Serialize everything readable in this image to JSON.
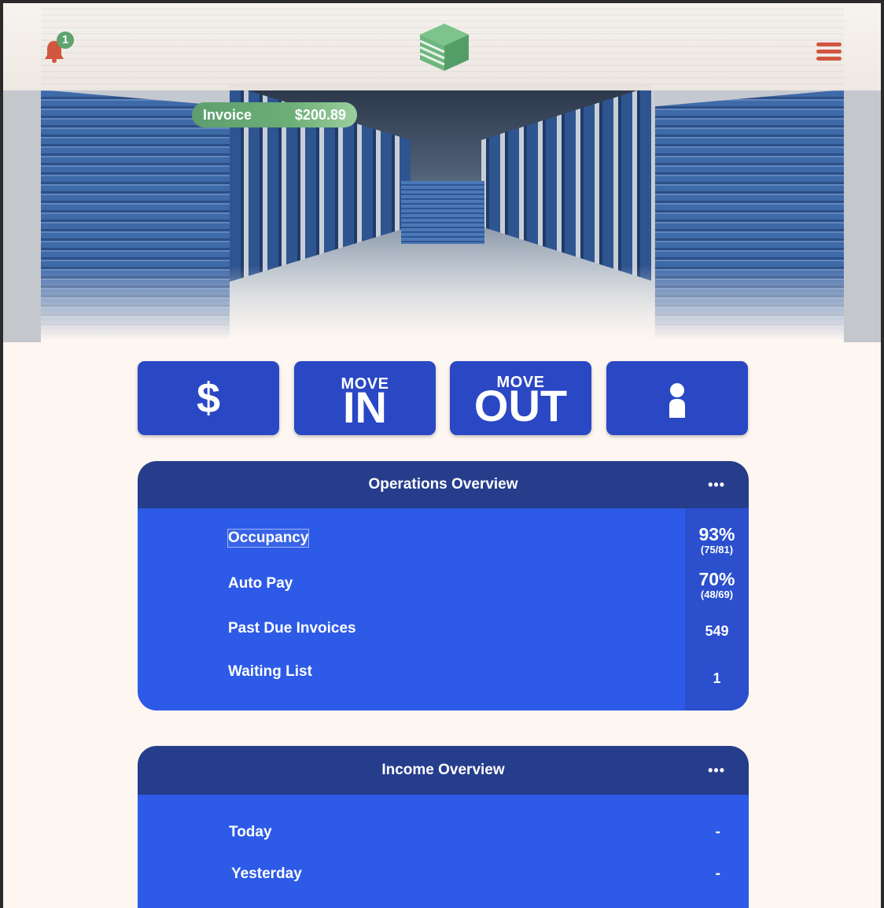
{
  "header": {
    "notification_count": "1",
    "logo_icon": "cube-logo-icon",
    "menu_icon": "hamburger-menu-icon"
  },
  "invoice": {
    "label": "Invoice",
    "amount": "$200.89"
  },
  "actions": {
    "payment_symbol": "$",
    "move_in_top": "MOVE",
    "move_in_big": "IN",
    "move_out_top": "MOVE",
    "move_out_big": "OUT",
    "profile_icon": "person-icon"
  },
  "operations": {
    "title": "Operations Overview",
    "more": "•••",
    "rows": [
      {
        "label": "Occupancy",
        "value": "93%",
        "detail": "(75/81)"
      },
      {
        "label": "Auto Pay",
        "value": "70%",
        "detail": "(48/69)"
      },
      {
        "label": "Past Due Invoices",
        "value": "549"
      },
      {
        "label": "Waiting List",
        "value": "1"
      }
    ]
  },
  "income": {
    "title": "Income Overview",
    "more": "•••",
    "rows": [
      {
        "label": "Today",
        "value": "-"
      },
      {
        "label": "Yesterday",
        "value": "-"
      }
    ]
  },
  "colors": {
    "accent_red": "#d2523a",
    "badge_green": "#5aa36b",
    "button_blue": "#2a47c4",
    "card_header": "#263d8c",
    "card_body": "#2d5ae6"
  }
}
